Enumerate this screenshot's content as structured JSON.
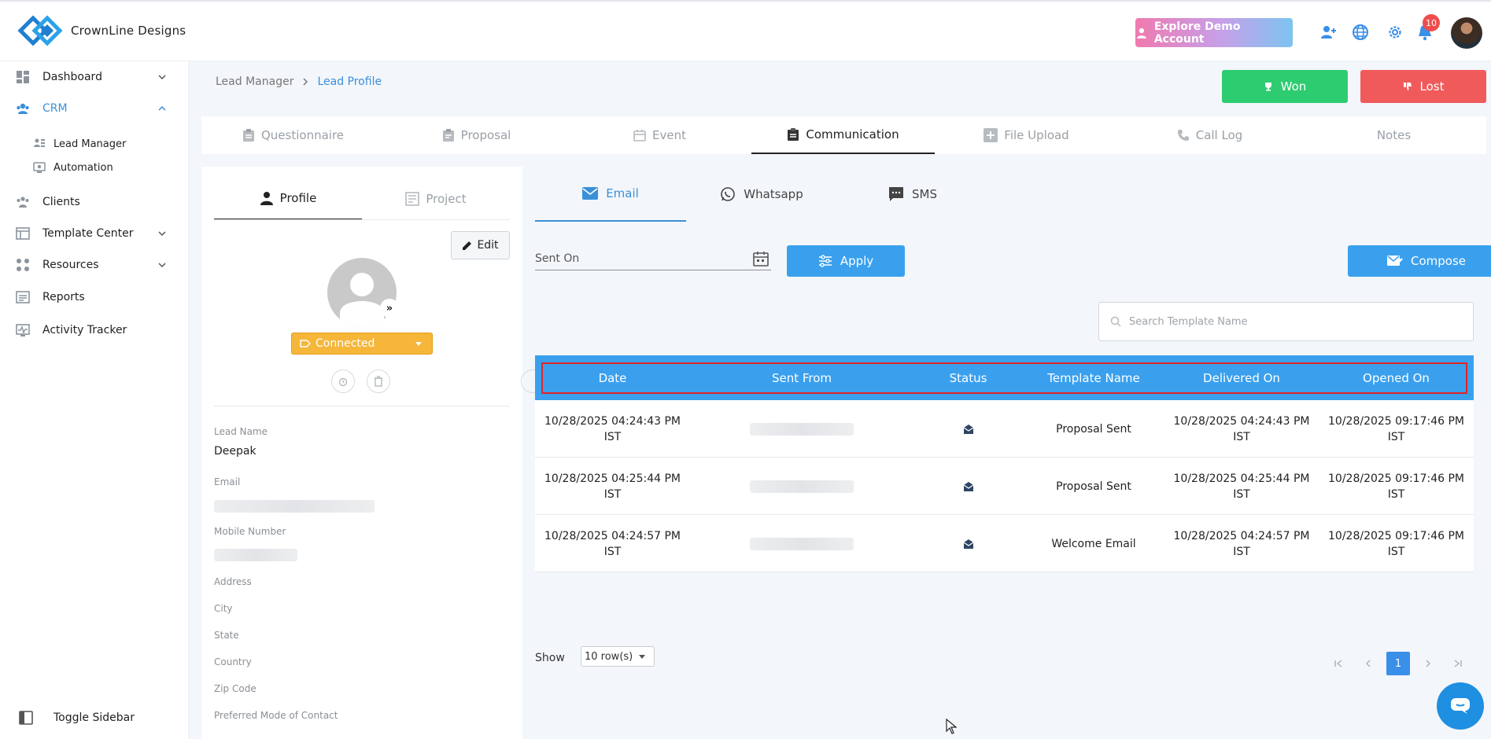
{
  "header": {
    "brand": "CrownLine Designs",
    "demo_button": "Explore Demo Account",
    "notification_count": "10",
    "colors": {
      "accent": "#3aa0ee",
      "won": "#2ecc71",
      "lost": "#f05a5a",
      "status": "#f5b63a"
    }
  },
  "sidebar": {
    "items": [
      {
        "label": "Dashboard",
        "icon": "dashboard-icon"
      },
      {
        "label": "CRM",
        "icon": "crm-icon"
      },
      {
        "label": "Lead Manager",
        "icon": "lead-manager-icon"
      },
      {
        "label": "Automation",
        "icon": "automation-icon"
      },
      {
        "label": "Clients",
        "icon": "clients-icon"
      },
      {
        "label": "Template Center",
        "icon": "template-icon"
      },
      {
        "label": "Resources",
        "icon": "resources-icon"
      },
      {
        "label": "Reports",
        "icon": "reports-icon"
      },
      {
        "label": "Activity Tracker",
        "icon": "activity-icon"
      }
    ],
    "toggle_label": "Toggle Sidebar"
  },
  "breadcrumb": {
    "parent": "Lead Manager",
    "current": "Lead Profile"
  },
  "actions": {
    "won": "Won",
    "lost": "Lost"
  },
  "tabs": [
    "Questionnaire",
    "Proposal",
    "Event",
    "Communication",
    "File Upload",
    "Call Log",
    "Notes"
  ],
  "profile": {
    "tabs": [
      "Profile",
      "Project"
    ],
    "edit_label": "Edit",
    "status": "Connected",
    "fields": {
      "lead_name_label": "Lead Name",
      "lead_name": "Deepak",
      "email_label": "Email",
      "mobile_label": "Mobile Number",
      "address_label": "Address",
      "city_label": "City",
      "state_label": "State",
      "country_label": "Country",
      "zip_label": "Zip Code",
      "contact_mode_label": "Preferred Mode of Contact"
    }
  },
  "communication": {
    "channels": [
      "Email",
      "Whatsapp",
      "SMS"
    ],
    "sent_on_label": "Sent On",
    "apply_label": "Apply",
    "compose_label": "Compose",
    "search_placeholder": "Search Template Name",
    "table": {
      "headers": [
        "Date",
        "Sent From",
        "Status",
        "Template Name",
        "Delivered On",
        "Opened On"
      ],
      "rows": [
        {
          "date": "10/28/2025 04:24:43 PM",
          "date_tz": "IST",
          "template": "Proposal Sent",
          "delivered": "10/28/2025 04:24:43 PM",
          "delivered_tz": "IST",
          "opened": "10/28/2025 09:17:46 PM",
          "opened_tz": "IST"
        },
        {
          "date": "10/28/2025 04:25:44 PM",
          "date_tz": "IST",
          "template": "Proposal Sent",
          "delivered": "10/28/2025 04:25:44 PM",
          "delivered_tz": "IST",
          "opened": "10/28/2025 09:17:46 PM",
          "opened_tz": "IST"
        },
        {
          "date": "10/28/2025 04:24:57 PM",
          "date_tz": "IST",
          "template": "Welcome Email",
          "delivered": "10/28/2025 04:24:57 PM",
          "delivered_tz": "IST",
          "opened": "10/28/2025 09:17:46 PM",
          "opened_tz": "IST"
        }
      ]
    },
    "show_label": "Show",
    "rows_per_page": "10 row(s)",
    "current_page": "1"
  }
}
